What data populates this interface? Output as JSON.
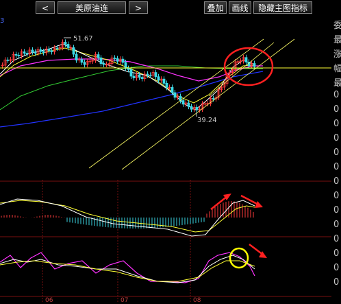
{
  "toolbar": {
    "prev_label": "<",
    "title": "美原油连",
    "next_label": ">",
    "overlay_label": "叠加",
    "draw_label": "画线",
    "hide_indicator_label": "隐藏主图指标"
  },
  "chart": {
    "high_label": "51.67",
    "low_label": "39.24",
    "corner_label": "3",
    "dates": [
      "06",
      "07",
      "08"
    ]
  },
  "right_column": [
    "委",
    "最",
    "涨",
    "幅",
    "最",
    "0",
    "0",
    "0",
    "0",
    "0",
    "0",
    "0",
    "0",
    "0",
    "0",
    "0",
    "0",
    "0",
    "0"
  ],
  "colors": {
    "up": "#ff3b3b",
    "down": "#3bd9e6",
    "ma_white": "#ffffff",
    "ma_yellow": "#ffff33",
    "ma_magenta": "#ff33ff",
    "ma_green": "#33cc33",
    "ma_blue": "#2233ff",
    "annotation_red": "#ff2020",
    "annotation_yellow": "#ffff00"
  }
}
